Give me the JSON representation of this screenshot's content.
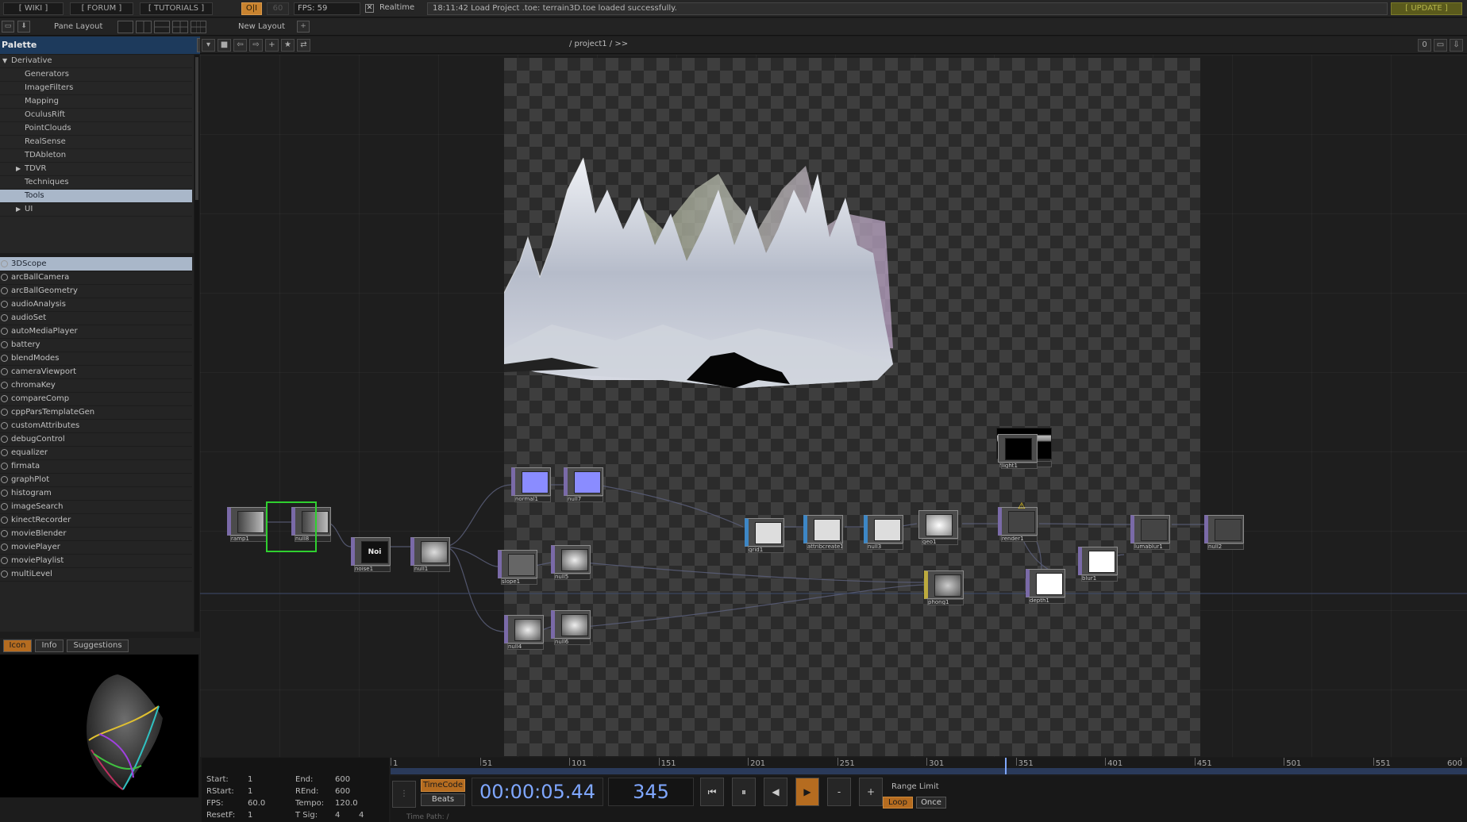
{
  "topbar": {
    "wiki": "[ WIKI ]",
    "forum": "[ FORUM ]",
    "tutorials": "[ TUTORIALS ]",
    "oi": "O|I",
    "sixty": "60",
    "fps": "FPS:  59",
    "realtime": "Realtime",
    "message": "18:11:42 Load Project .toe: terrain3D.toe loaded successfully.",
    "update": "[ UPDATE ]"
  },
  "row2": {
    "pane_layout": "Pane Layout",
    "new_layout": "New Layout",
    "plus": "+"
  },
  "palette": {
    "title": "Palette",
    "help": "?",
    "close": "×",
    "tree": [
      {
        "label": "Derivative",
        "arrow": "▼",
        "indent": 0
      },
      {
        "label": "Generators",
        "arrow": "",
        "indent": 2
      },
      {
        "label": "ImageFilters",
        "arrow": "",
        "indent": 2
      },
      {
        "label": "Mapping",
        "arrow": "",
        "indent": 2
      },
      {
        "label": "OculusRift",
        "arrow": "",
        "indent": 2
      },
      {
        "label": "PointClouds",
        "arrow": "",
        "indent": 2
      },
      {
        "label": "RealSense",
        "arrow": "",
        "indent": 2
      },
      {
        "label": "TDAbleton",
        "arrow": "",
        "indent": 2
      },
      {
        "label": "TDVR",
        "arrow": "▶",
        "indent": 2
      },
      {
        "label": "Techniques",
        "arrow": "",
        "indent": 2
      },
      {
        "label": "Tools",
        "arrow": "",
        "indent": 2,
        "selected": true
      },
      {
        "label": "UI",
        "arrow": "▶",
        "indent": 2
      }
    ],
    "items": [
      "3DScope",
      "arcBallCamera",
      "arcBallGeometry",
      "audioAnalysis",
      "audioSet",
      "autoMediaPlayer",
      "battery",
      "blendModes",
      "cameraViewport",
      "chromaKey",
      "compareComp",
      "cppParsTemplateGen",
      "customAttributes",
      "debugControl",
      "equalizer",
      "firmata",
      "graphPlot",
      "histogram",
      "imageSearch",
      "kinectRecorder",
      "movieBlender",
      "moviePlayer",
      "moviePlaylist",
      "multiLevel"
    ],
    "tabs": {
      "icon": "Icon",
      "info": "Info",
      "suggestions": "Suggestions"
    }
  },
  "network": {
    "path": "/ project1  /  >>",
    "zero": "0",
    "nodes": [
      {
        "name": "ramp1",
        "family": "top"
      },
      {
        "name": "null8",
        "family": "top"
      },
      {
        "name": "noise1",
        "family": "top",
        "thumb_text": "Noi"
      },
      {
        "name": "null1",
        "family": "top"
      },
      {
        "name": "normal1",
        "family": "top"
      },
      {
        "name": "null7",
        "family": "top"
      },
      {
        "name": "slope1",
        "family": "top"
      },
      {
        "name": "null5",
        "family": "top"
      },
      {
        "name": "null4",
        "family": "top"
      },
      {
        "name": "null6",
        "family": "top"
      },
      {
        "name": "grid1",
        "family": "sop"
      },
      {
        "name": "attribcreate1",
        "family": "sop"
      },
      {
        "name": "null3",
        "family": "sop"
      },
      {
        "name": "geo1",
        "family": "comp"
      },
      {
        "name": "cam1",
        "family": "comp"
      },
      {
        "name": "light1",
        "family": "comp"
      },
      {
        "name": "phong1",
        "family": "mat"
      },
      {
        "name": "render1",
        "family": "top"
      },
      {
        "name": "depth1",
        "family": "top"
      },
      {
        "name": "blur1",
        "family": "top"
      },
      {
        "name": "lumablur1",
        "family": "top"
      },
      {
        "name": "null2",
        "family": "top"
      }
    ]
  },
  "timeline": {
    "start_label": "Start:",
    "start": "1",
    "end_label": "End:",
    "end": "600",
    "rstart_label": "RStart:",
    "rstart": "1",
    "rend_label": "REnd:",
    "rend": "600",
    "fps_label": "FPS:",
    "fps": "60.0",
    "tempo_label": "Tempo:",
    "tempo": "120.0",
    "resetf_label": "ResetF:",
    "resetf": "1",
    "tsig_label": "T Sig:",
    "tsig_a": "4",
    "tsig_b": "4",
    "ruler": [
      "1",
      "51",
      "101",
      "151",
      "201",
      "251",
      "301",
      "351",
      "401",
      "451",
      "501",
      "551",
      "600"
    ],
    "timecode_btn": "TimeCode",
    "beats_btn": "Beats",
    "timecode": "00:00:05.44",
    "frame": "345",
    "current_frame_value": 345,
    "range_limit": "Range Limit",
    "loop": "Loop",
    "once": "Once",
    "time_path": "Time Path: /",
    "minus": "-",
    "plus": "+"
  },
  "colors": {
    "palette_header": "#1d3a5c",
    "selection": "#a9b7c9",
    "accent_orange": "#c9832f",
    "timecode_blue": "#7fa7ff",
    "selected_node_border": "#2fd02f"
  }
}
